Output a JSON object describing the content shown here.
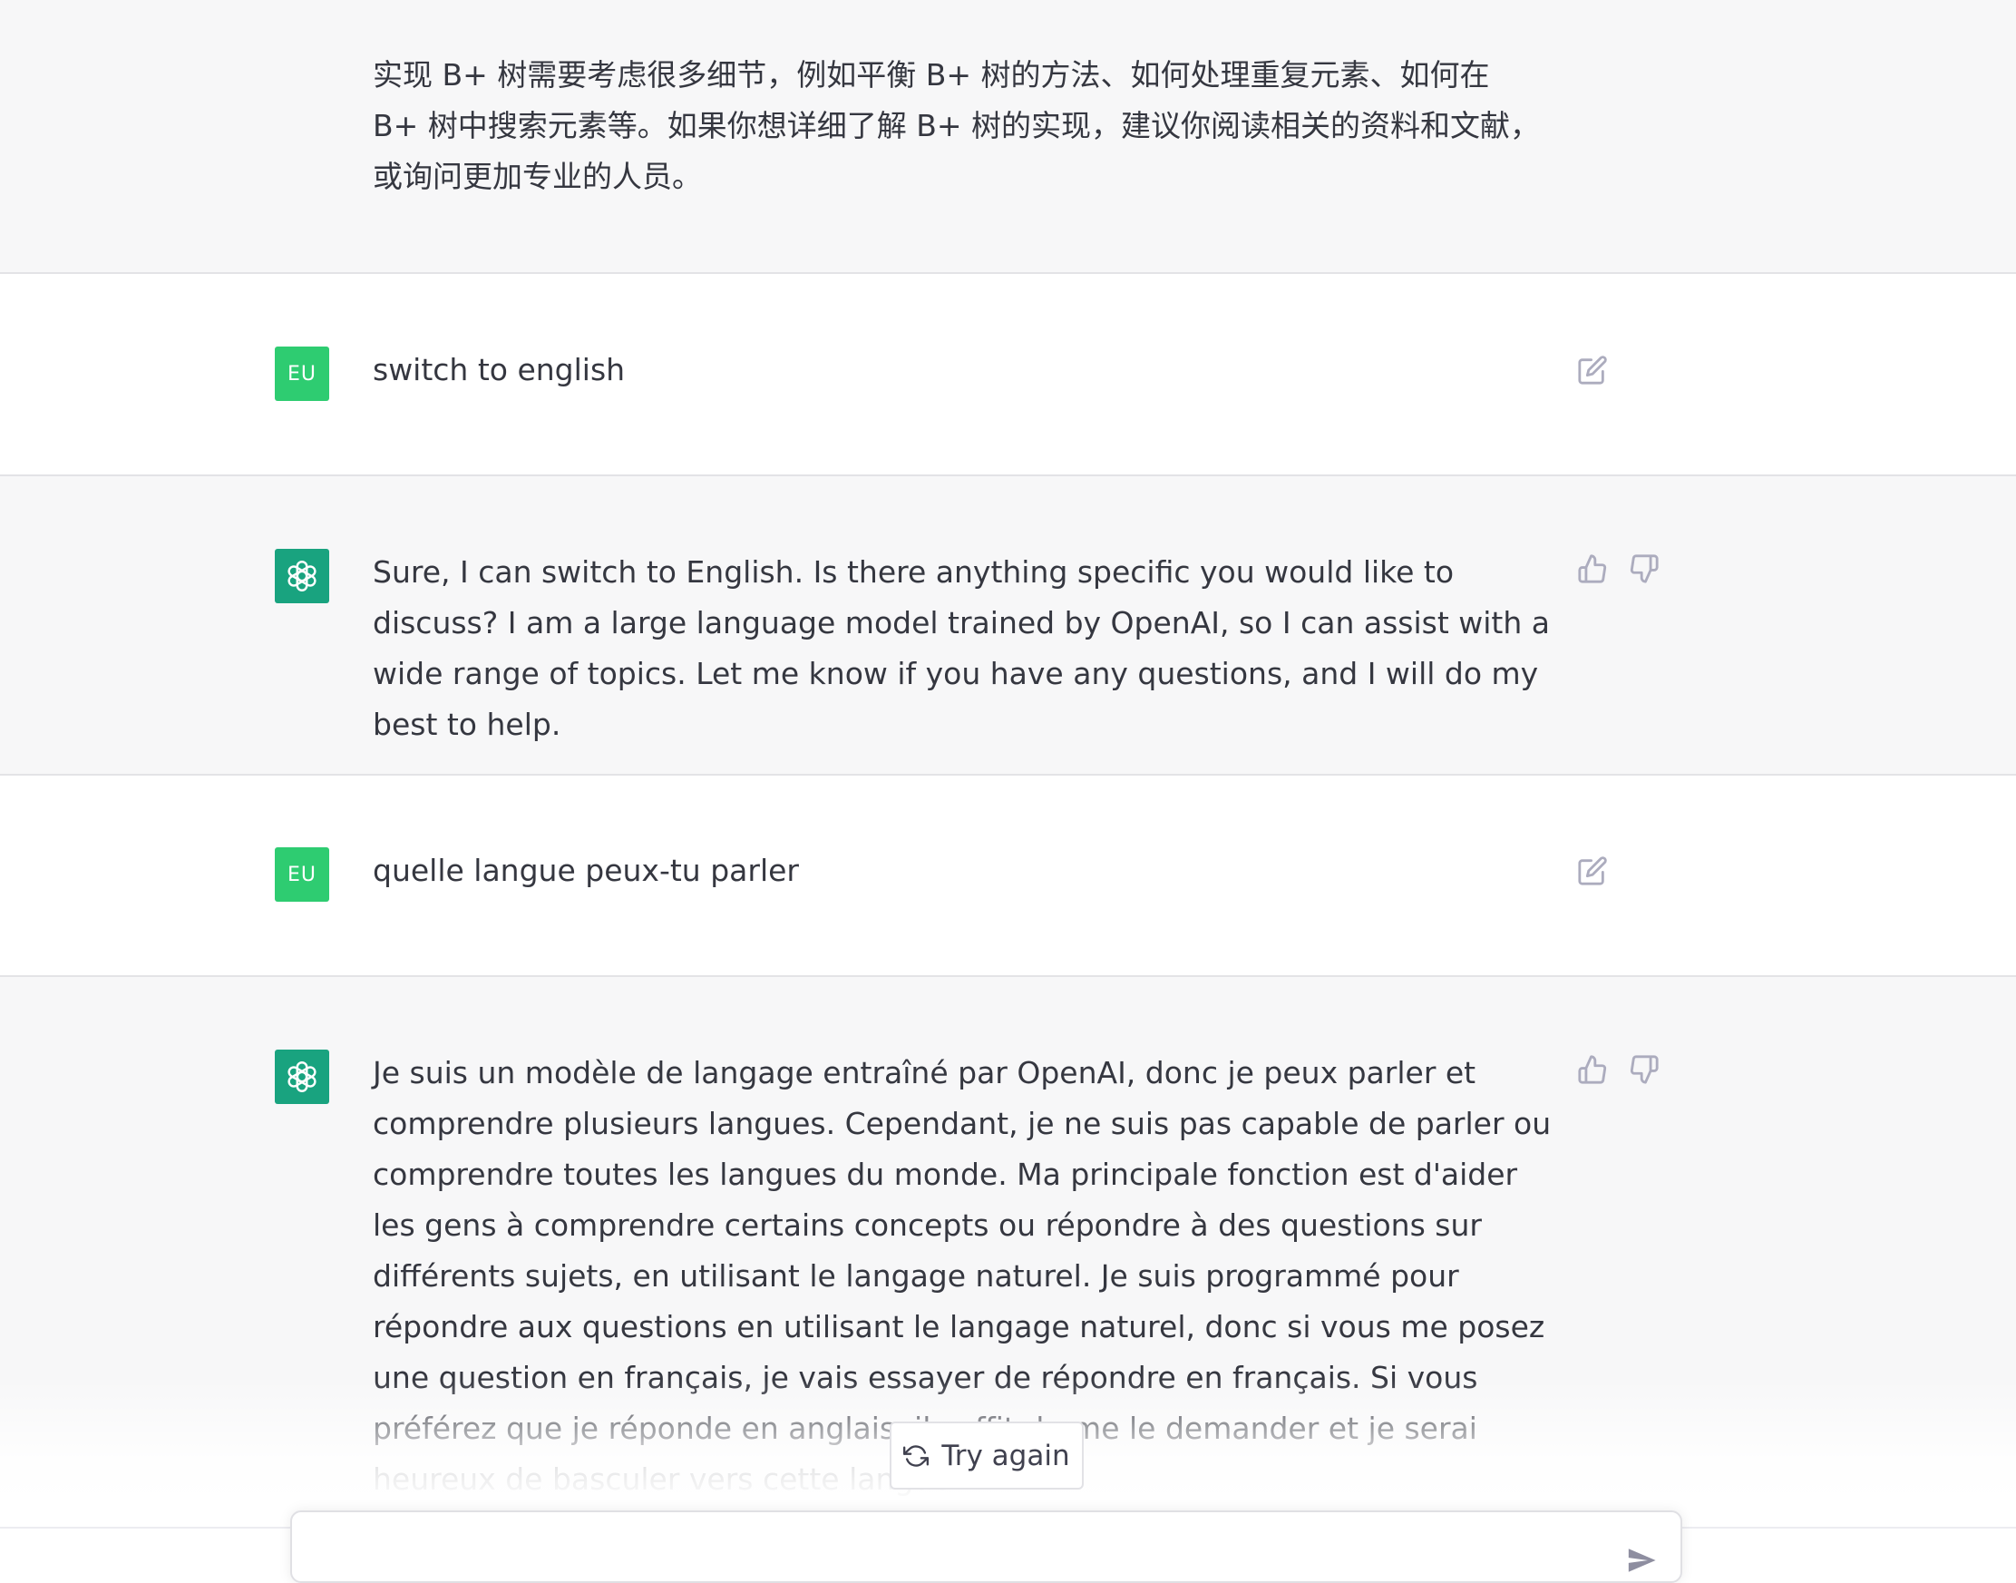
{
  "conversation": [
    {
      "role": "assistant",
      "paragraphs": [
        "实现 B+ 树需要考虑很多细节，例如平衡 B+ 树的方法、如何处理重复元素、如何在 B+ 树中搜索元素等。如果你想详细了解 B+ 树的实现，建议你阅读相关的资料和文献，或询问更加专业的人员。"
      ]
    },
    {
      "role": "user",
      "avatar_label": "EU",
      "text": "switch to english",
      "edit_icon": "edit-icon"
    },
    {
      "role": "assistant",
      "avatar_icon": "openai-logo-icon",
      "text": "Sure, I can switch to English. Is there anything specific you would like to discuss? I am a large language model trained by OpenAI, so I can assist with a wide range of topics. Let me know if you have any questions, and I will do my best to help.",
      "feedback_icons": [
        "thumbs-up-icon",
        "thumbs-down-icon"
      ]
    },
    {
      "role": "user",
      "avatar_label": "EU",
      "text": "quelle langue peux-tu parler",
      "edit_icon": "edit-icon"
    },
    {
      "role": "assistant",
      "avatar_icon": "openai-logo-icon",
      "text": "Je suis un modèle de langage entraîné par OpenAI, donc je peux parler et comprendre plusieurs langues. Cependant, je ne suis pas capable de parler ou comprendre toutes les langues du monde. Ma principale fonction est d'aider les gens à comprendre certains concepts ou répondre à des questions sur différents sujets, en utilisant le langage naturel. Je suis programmé pour répondre aux questions en utilisant le langage naturel, donc si vous me posez une question en français, je vais essayer de répondre en français. Si vous préférez que je réponde en anglais, il suffit de me le demander et je serai heureux de basculer vers cette langue.",
      "feedback_icons": [
        "thumbs-up-icon",
        "thumbs-down-icon"
      ]
    }
  ],
  "try_again": {
    "label": "Try again",
    "icon": "refresh-icon"
  },
  "composer": {
    "placeholder": "",
    "send_icon": "send-icon"
  },
  "colors": {
    "assistant_bg": "#f7f7f8",
    "user_bg": "#ffffff",
    "user_avatar": "#2ecc71",
    "assistant_avatar": "#19a37f",
    "text": "#353740",
    "icon": "#acacbe"
  }
}
